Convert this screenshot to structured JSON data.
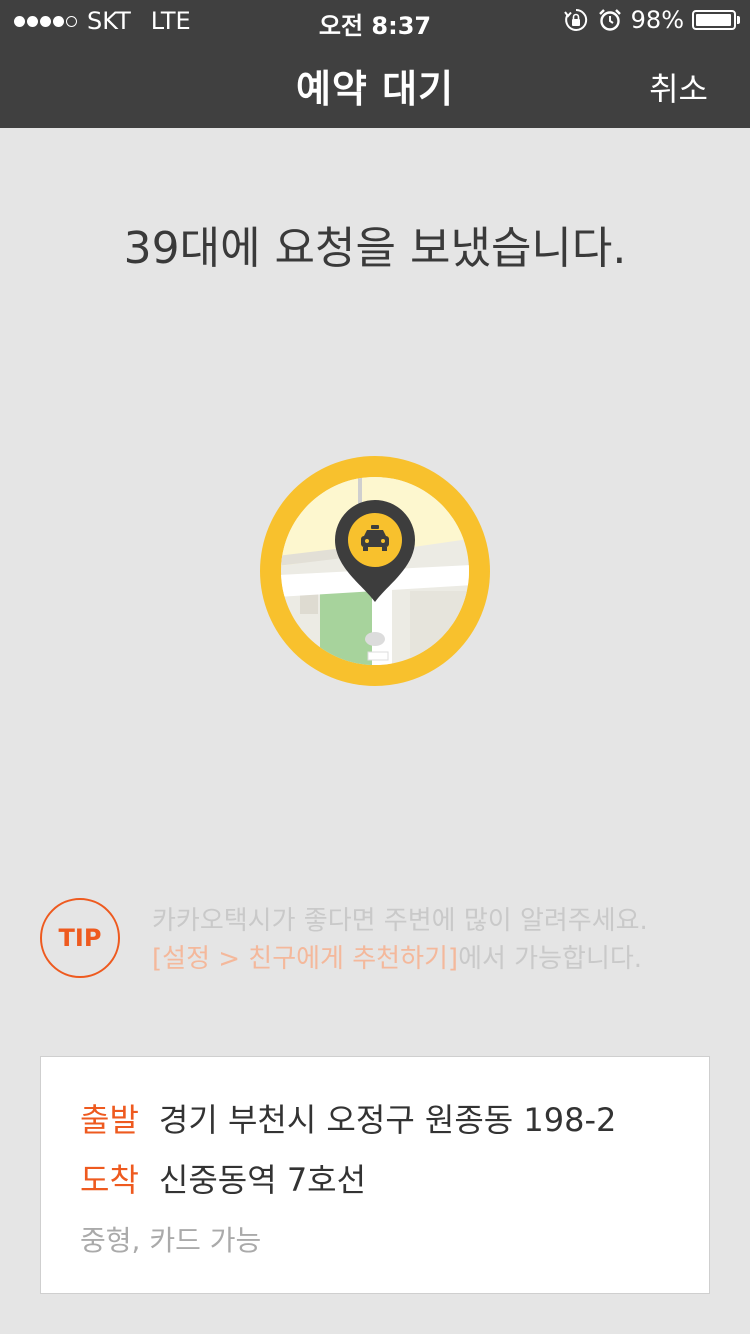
{
  "status_bar": {
    "carrier": "SKT",
    "network": "LTE",
    "time": "오전 8:37",
    "battery_percent": "98%",
    "battery_level": 0.98,
    "icons": [
      "rotation-lock-icon",
      "alarm-icon"
    ]
  },
  "nav": {
    "title": "예약 대기",
    "cancel_label": "취소"
  },
  "headline": "39대에 요청을 보냈습니다.",
  "tip": {
    "badge": "TIP",
    "line1": "카카오택시가 좋다면 주변에 많이 알려주세요.",
    "link": "[설정 > 친구에게 추천하기]",
    "line2_suffix": "에서 가능합니다."
  },
  "trip": {
    "departure_label": "출발",
    "departure_value": "경기 부천시 오정구 원종동 198-2",
    "arrival_label": "도착",
    "arrival_value": "신중동역 7호선",
    "extra": "중형, 카드 가능"
  },
  "colors": {
    "accent": "#ee5a1f",
    "header_bg": "#404040",
    "map_ring": "#f8c12d"
  }
}
